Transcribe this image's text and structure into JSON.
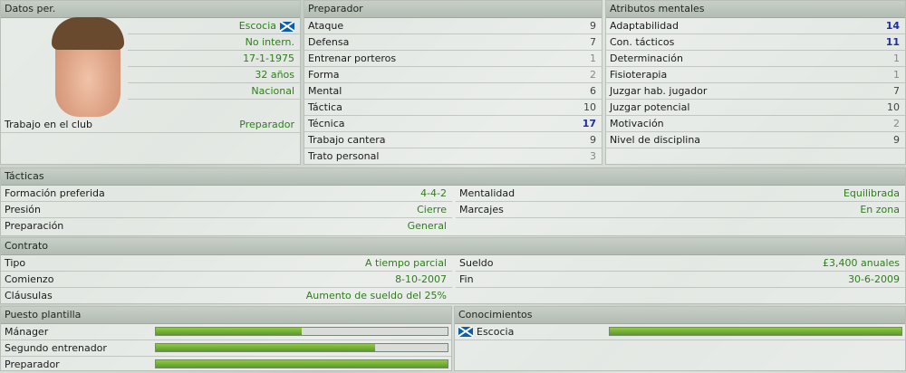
{
  "datos": {
    "header": "Datos per.",
    "nacionalidad": "Escocia",
    "internacional": "No intern.",
    "nacimiento": "17-1-1975",
    "edad": "32 años",
    "reputacion": "Nacional",
    "trabajo_label": "Trabajo en el club",
    "trabajo_value": "Preparador"
  },
  "preparador": {
    "header": "Preparador",
    "items": [
      {
        "label": "Ataque",
        "value": "9"
      },
      {
        "label": "Defensa",
        "value": "7"
      },
      {
        "label": "Entrenar porteros",
        "value": "1"
      },
      {
        "label": "Forma",
        "value": "2"
      },
      {
        "label": "Mental",
        "value": "6"
      },
      {
        "label": "Táctica",
        "value": "10"
      },
      {
        "label": "Técnica",
        "value": "17"
      },
      {
        "label": "Trabajo cantera",
        "value": "9"
      },
      {
        "label": "Trato personal",
        "value": "3"
      }
    ]
  },
  "mentales": {
    "header": "Atributos mentales",
    "items": [
      {
        "label": "Adaptabilidad",
        "value": "14"
      },
      {
        "label": "Con. tácticos",
        "value": "11"
      },
      {
        "label": "Determinación",
        "value": "1"
      },
      {
        "label": "Fisioterapia",
        "value": "1"
      },
      {
        "label": "Juzgar hab. jugador",
        "value": "7"
      },
      {
        "label": "Juzgar potencial",
        "value": "10"
      },
      {
        "label": "Motivación",
        "value": "2"
      },
      {
        "label": "Nivel de disciplina",
        "value": "9"
      }
    ]
  },
  "tacticas": {
    "header": "Tácticas",
    "formacion_label": "Formación preferida",
    "formacion_value": "4-4-2",
    "presion_label": "Presión",
    "presion_value": "Cierre",
    "preparacion_label": "Preparación",
    "preparacion_value": "General",
    "mentalidad_label": "Mentalidad",
    "mentalidad_value": "Equilibrada",
    "marcajes_label": "Marcajes",
    "marcajes_value": "En zona"
  },
  "contrato": {
    "header": "Contrato",
    "tipo_label": "Tipo",
    "tipo_value": "A tiempo parcial",
    "comienzo_label": "Comienzo",
    "comienzo_value": "8-10-2007",
    "clausulas_label": "Cláusulas",
    "clausulas_value": "Aumento de sueldo del 25%",
    "sueldo_label": "Sueldo",
    "sueldo_value": "£3,400 anuales",
    "fin_label": "Fin",
    "fin_value": "30-6-2009"
  },
  "puesto": {
    "header": "Puesto plantilla",
    "items": [
      {
        "label": "Mánager",
        "level": 0.5
      },
      {
        "label": "Segundo entrenador",
        "level": 0.75
      },
      {
        "label": "Preparador",
        "level": 1.0
      }
    ]
  },
  "conocimientos": {
    "header": "Conocimientos",
    "items": [
      {
        "label": "Escocia",
        "level": 1.0
      }
    ]
  }
}
